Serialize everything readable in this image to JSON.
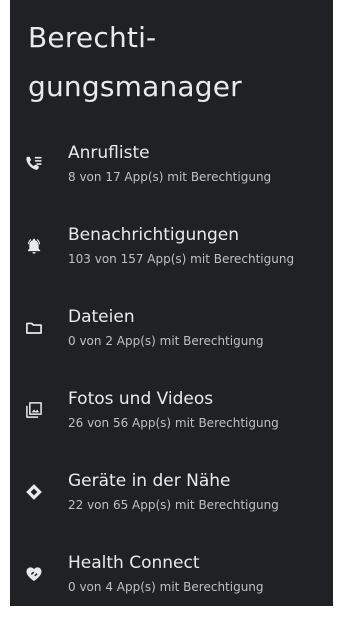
{
  "header": {
    "title_line1": "Berechti-",
    "title_line2": "gungsmanager"
  },
  "permissions": [
    {
      "label": "Anrufliste",
      "summary": "8 von 17 App(s) mit Berechtigung",
      "icon": "call-log-icon"
    },
    {
      "label": "Benachrichtigungen",
      "summary": "103 von 157 App(s) mit Berechtigung",
      "icon": "notification-bell-icon"
    },
    {
      "label": "Dateien",
      "summary": "0 von 2 App(s) mit Berechtigung",
      "icon": "folder-icon"
    },
    {
      "label": "Fotos und Videos",
      "summary": "26 von 56 App(s) mit Berechtigung",
      "icon": "photo-library-icon"
    },
    {
      "label": "Geräte in der Nähe",
      "summary": "22 von 65 App(s) mit Berechtigung",
      "icon": "nearby-devices-icon"
    },
    {
      "label": "Health Connect",
      "summary": "0 von 4 App(s) mit Berechtigung",
      "icon": "health-connect-icon"
    }
  ],
  "colors": {
    "background": "#202124",
    "primary_text": "#e8eaed",
    "secondary_text": "#bdc1c6",
    "icon": "#e8eaed"
  }
}
